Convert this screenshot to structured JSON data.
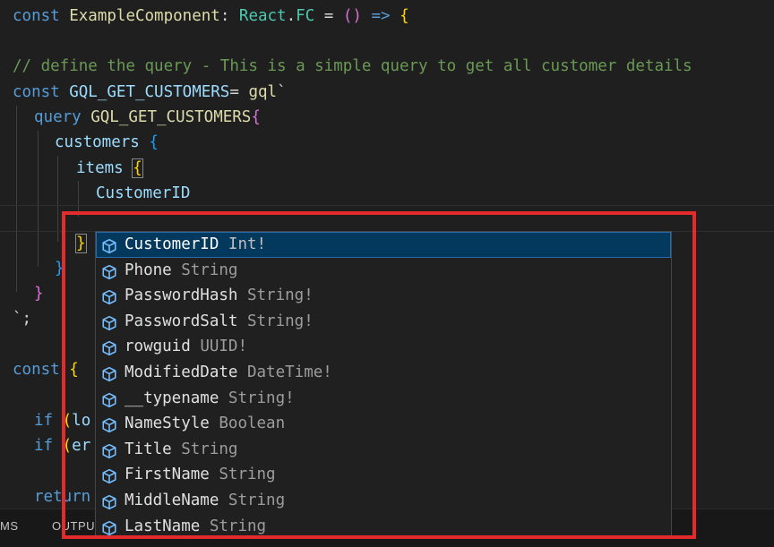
{
  "code": {
    "l1": {
      "kw": "const",
      "name": "ExampleComponent",
      "colon": ":",
      "ty1": "React",
      "dot": ".",
      "ty2": "FC",
      "eq": " = ",
      "paren": "()",
      "arrow": " => ",
      "brace": "{"
    },
    "l3": {
      "comment": "// define the query - This is a simple query to get all customer details"
    },
    "l4": {
      "kw": "const",
      "name": "GQL_GET_CUSTOMERS",
      "eq": "=",
      "fn": "gql",
      "tick": "`"
    },
    "l5": {
      "kw": "query",
      "name": "GQL_GET_CUSTOMERS",
      "brace": "{"
    },
    "l6": {
      "name": "customers",
      "brace": "{"
    },
    "l7": {
      "name": "items",
      "brace": "{"
    },
    "l8": {
      "name": "CustomerID"
    },
    "l10": {
      "brace": "}"
    },
    "l11": {
      "brace": "}"
    },
    "l12": {
      "brace": "}"
    },
    "l13": {
      "text": "`;"
    },
    "l15": {
      "kw": "const",
      "brace": "{"
    },
    "l17": {
      "kw": "if",
      "paren": "(",
      "frag": "lo"
    },
    "l18": {
      "kw": "if",
      "paren": "(",
      "frag": "er"
    },
    "l20": {
      "kw": "return"
    }
  },
  "suggestions": [
    {
      "label": "CustomerID",
      "detail": "Int!"
    },
    {
      "label": "Phone",
      "detail": "String"
    },
    {
      "label": "PasswordHash",
      "detail": "String!"
    },
    {
      "label": "PasswordSalt",
      "detail": "String!"
    },
    {
      "label": "rowguid",
      "detail": "UUID!"
    },
    {
      "label": "ModifiedDate",
      "detail": "DateTime!"
    },
    {
      "label": "__typename",
      "detail": "String!"
    },
    {
      "label": "NameStyle",
      "detail": "Boolean"
    },
    {
      "label": "Title",
      "detail": "String"
    },
    {
      "label": "FirstName",
      "detail": "String"
    },
    {
      "label": "MiddleName",
      "detail": "String"
    },
    {
      "label": "LastName",
      "detail": "String"
    }
  ],
  "suggest_icon": "field-cube-icon",
  "panel": {
    "tab1": "MS",
    "tab2": "OUTPU"
  },
  "colors": {
    "highlight": "#e32b2b",
    "selected": "#04395e",
    "keyword": "#569cd6",
    "type": "#4ec9b0",
    "comment": "#6a9955"
  }
}
